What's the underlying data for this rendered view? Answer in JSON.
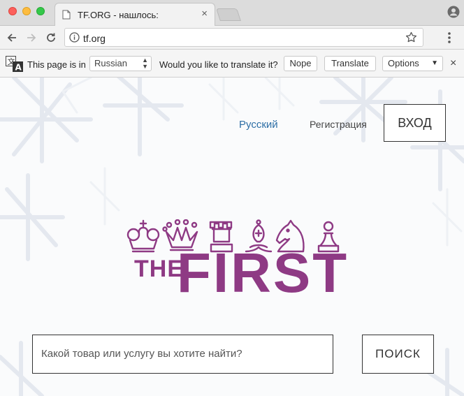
{
  "browser": {
    "tab": {
      "title": "TF.ORG - нашлось:"
    },
    "address_bar": {
      "url": "tf.org"
    },
    "translate_bar": {
      "page_in_text": "This page is in",
      "language": "Russian",
      "question": "Would you like to translate it?",
      "nope_label": "Nope",
      "translate_label": "Translate",
      "options_label": "Options"
    }
  },
  "header": {
    "language_link": "Русский",
    "register_link": "Регистрация",
    "login_button": "ВХОД"
  },
  "logo": {
    "the": "THE",
    "first": "FIRST"
  },
  "search": {
    "placeholder": "Какой товар или услугу вы хотите найти?",
    "button_label": "ПОИСК"
  },
  "colors": {
    "brand_purple": "#8e3a84",
    "link_blue": "#2e6fa6"
  }
}
